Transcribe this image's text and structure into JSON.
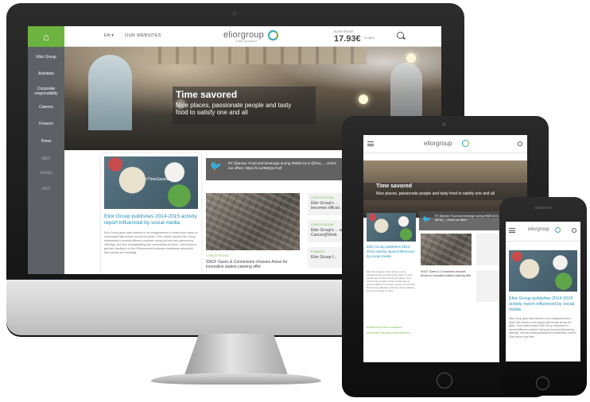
{
  "desktop": {
    "lang": "EN",
    "our_websites": "OUR WEBSITES",
    "logo": "eliorgroup",
    "logo_tagline": "time savored",
    "stock_label": "ELIOR GROUP",
    "stock_price": "17.93€",
    "stock_change": "+0.28%",
    "sidebar": [
      "Elior Group",
      "Activities",
      "Corporate responsibility",
      "Careers",
      "Finance",
      "Press"
    ],
    "sidebar_brands": [
      "elior",
      "areas",
      "elior"
    ],
    "hero_title": "Time savored",
    "hero_subtitle": "Nice places, passionate people and tasty food to satisfy one and all",
    "tweet": "RT @areas: Food and beverage during #MWC15 in @Fira_... check our offers: https://t.co/3NBQuYs2f",
    "card_hashtag": "#TimeSavored",
    "card_title": "Elior Group publishes 2014-2015 activity report influenced by social media",
    "card_body": "Elior Group gave carte blanche to six Instagrammers to share their views on how people take breaks across the globe. They visited various Elior Group restaurants in several different countries, trying out food and discovering offerings, and then photographing and commenting on them. Click below to get their feedback on the #Timesavored customer experience along with their photos and hashtags.",
    "tag_concession": "CONCESSIONS",
    "news_city_title": "SNCF Gares & Connexions chooses Areas for innovative station catering offer",
    "side_news": [
      {
        "tag": "CONCESSIONS",
        "text": "Elior Group's ... becomes official ..."
      },
      {
        "tag": "CONCESSIONS",
        "text": "Elior Group's ... with Cancer@Work"
      },
      {
        "tag": "FINANCE",
        "text": "Elior Group f..."
      }
    ]
  },
  "tablet": {
    "logo": "eliorgroup",
    "hero_title": "Time savored",
    "hero_subtitle": "Nice places, passionate people and tasty food to satisfy one and all",
    "tweet": "RT @areas: Food and beverage during #MWC15 in @Fira_... check our offers",
    "card_title": "Elior Group publishes 2014-2015 activity report influenced by social media",
    "card_body": "Elior Group gave carte blanche to six Instagrammers to share their views on how people take breaks across the globe. They visited various Elior Group restaurants in several different countries, trying out food and discovering offerings, and then photographing and commenting on them.",
    "links": [
      "DOWNLOAD THE DOCUMENTS",
      "DISCOVER THE DEDICATED WEBSITE"
    ],
    "news_city_title": "SNCF Gares & Connexions chooses Areas for innovative station catering offer",
    "follow": "Follow"
  },
  "phone": {
    "logo": "eliorgroup",
    "card_title": "Elior Group publishes 2014-2015 activity report influenced by social media",
    "card_body": "Elior Group gave carte blanche to six Instagrammers to share their views on how people take breaks across the globe. They visited various Elior Group restaurants in several different countries, trying out food and discovering offerings, and then photographing and commenting on them. Click below to get their"
  }
}
